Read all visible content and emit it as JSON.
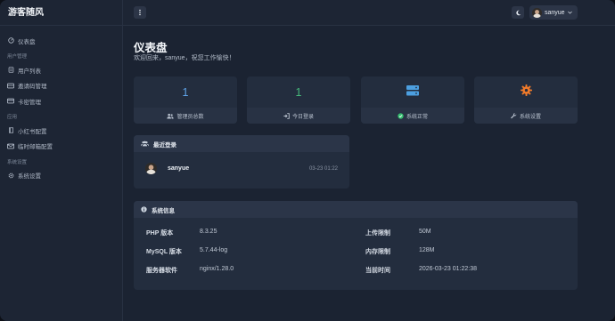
{
  "brand": "游客随风",
  "sidebar": {
    "dashboard": "仪表盘",
    "section_user": "用户管理",
    "user_list": "用户列表",
    "invite_codes": "邀请码管理",
    "card_keys": "卡密管理",
    "section_apps": "应用",
    "xiaohongshu": "小红书配置",
    "temp_mail": "临时邮箱配置",
    "section_system": "系统设置",
    "system_settings": "系统设置"
  },
  "topbar": {
    "menu_icon": "ellipsis-vertical-icon",
    "theme_icon": "moon-icon",
    "username": "sanyue"
  },
  "page": {
    "title": "仪表盘",
    "welcome": "欢迎回来，sanyue，祝您工作愉快！"
  },
  "stats": [
    {
      "value": "1",
      "label": "管理员总数",
      "value_color": "#5fa3e8",
      "icon": "users-icon"
    },
    {
      "value": "1",
      "label": "今日登录",
      "value_color": "#46b97a",
      "icon": "sign-in-icon"
    },
    {
      "label": "系统正常",
      "icon": "server-icon",
      "icon_color": "#4c9fe0",
      "status_icon": "check-circle-icon",
      "status_color": "#36c070"
    },
    {
      "label": "系统设置",
      "icon": "gear-icon",
      "icon_color": "#f07a2a",
      "status_icon": "wrench-icon"
    }
  ],
  "recent_login": {
    "title": "最近登录",
    "username": "sanyue",
    "time": "03-23 01:22"
  },
  "system_info": {
    "title": "系统信息",
    "php_label": "PHP 版本",
    "php_value": "8.3.25",
    "mysql_label": "MySQL 版本",
    "mysql_value": "5.7.44-log",
    "server_label": "服务器软件",
    "server_value": "nginx/1.28.0",
    "upload_label": "上传限制",
    "upload_value": "50M",
    "memory_label": "内存限制",
    "memory_value": "128M",
    "time_label": "当前时间",
    "time_value": "2026-03-23 01:22:38"
  }
}
